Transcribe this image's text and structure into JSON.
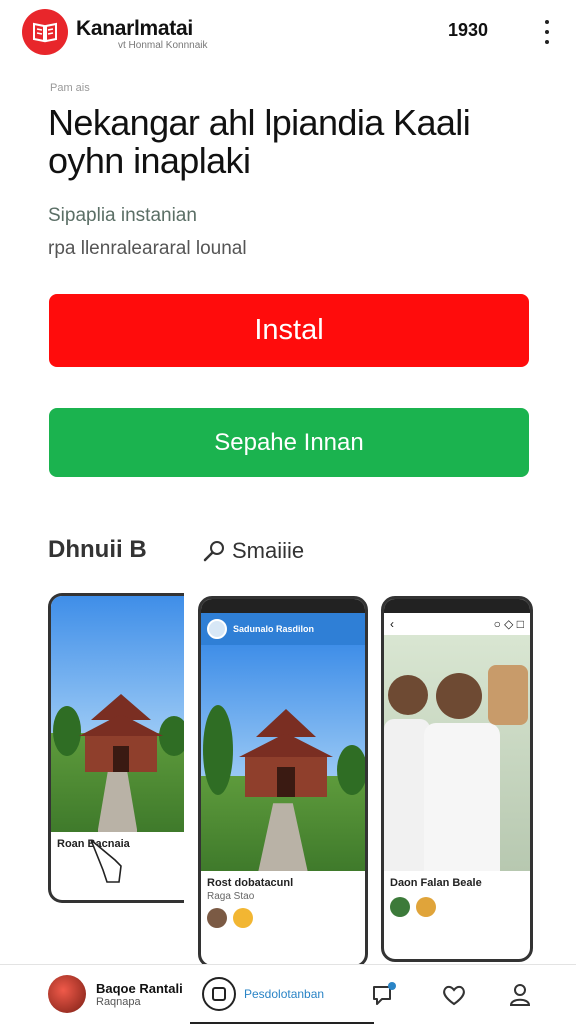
{
  "header": {
    "app_name": "Kanarlmatai",
    "app_subtitle": "vt Honmal Konnnaik",
    "time": "1930"
  },
  "meta_label": "Pam ais",
  "title": "Nekangar ahl lpiandia Kaali oyhn inaplaki",
  "subtitle_line1": "Sipaplia instanian",
  "subtitle_line2": "rpa llenraleararal lounal",
  "buttons": {
    "install": "Instal",
    "secondary": "Sepahe Innan"
  },
  "colors": {
    "install_bg": "#ff0c0c",
    "secondary_bg": "#1bb34f",
    "logo_bg": "#e8262b"
  },
  "section": {
    "heading": "Dhnuii B",
    "search_label": "Smaiiie"
  },
  "screenshots": [
    {
      "caption": "Roan Bacnaia",
      "sub": ""
    },
    {
      "header_text": "Sadunalo Rasdilon",
      "caption": "Rost dobatacunl",
      "sub": "Raga Stao"
    },
    {
      "caption": "Daon Falan Beale",
      "sub": ""
    }
  ],
  "bottom_nav": {
    "profile_name": "Baqoe Rantali",
    "profile_sub": "Raqnapa",
    "center_label": "Pesdolotanban"
  }
}
